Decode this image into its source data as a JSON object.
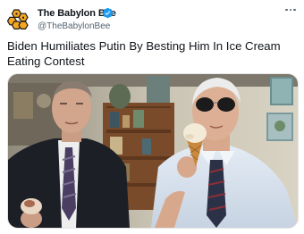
{
  "author": {
    "name": "The Babylon Bee",
    "handle": "@TheBabylonBee",
    "verified": true,
    "avatar_icon": "babylon-bee-logo",
    "verified_color": "#1d9bf0",
    "logo_color": "#f5a623"
  },
  "menu": {
    "icon": "more-horizontal-icon"
  },
  "tweet": {
    "text": "Biden Humiliates Putin By Besting Him In Ice Cream Eating Contest"
  },
  "media": {
    "type": "photo"
  }
}
